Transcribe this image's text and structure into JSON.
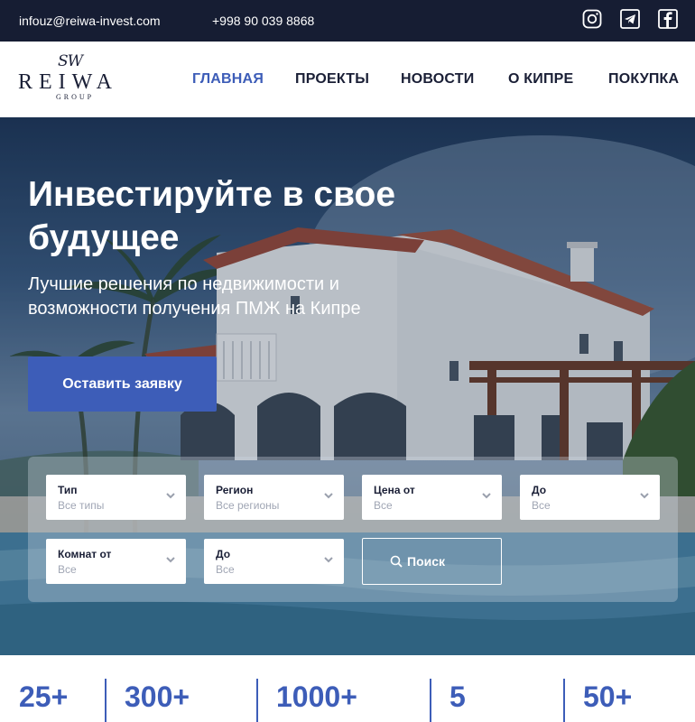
{
  "topbar": {
    "email": "infouz@reiwa-invest.com",
    "phone": "+998 90 039 8868",
    "social": [
      {
        "icon": "instagram-icon"
      },
      {
        "icon": "telegram-icon"
      },
      {
        "icon": "facebook-icon"
      }
    ]
  },
  "logo": {
    "mark": "SW",
    "word": "REIWA",
    "sub": "GROUP"
  },
  "nav": {
    "items": [
      {
        "label": "ГЛАВНАЯ",
        "active": true
      },
      {
        "label": "ПРОЕКТЫ"
      },
      {
        "label": "НОВОСТИ"
      },
      {
        "label": "О КИПРЕ"
      },
      {
        "label": "ПОКУПКА"
      }
    ]
  },
  "hero": {
    "title": "Инвестируйте в свое будущее",
    "subtitle": "Лучшие решения по недвижимости и возможности получения ПМЖ на Кипре",
    "cta_label": "Оставить заявку"
  },
  "search": {
    "fields": [
      {
        "label": "Тип",
        "value": "Все типы"
      },
      {
        "label": "Регион",
        "value": "Все регионы"
      },
      {
        "label": "Цена от",
        "value": "Все"
      },
      {
        "label": "До",
        "value": "Все"
      },
      {
        "label": "Комнат от",
        "value": "Все"
      },
      {
        "label": "До",
        "value": "Все"
      }
    ],
    "button_label": "Поиск"
  },
  "stats": {
    "values": [
      "25+",
      "300+",
      "1000+",
      "5",
      "50+"
    ]
  },
  "colors": {
    "accent": "#3d5db8",
    "topbar": "#161d33",
    "text": "#1a1f36"
  }
}
